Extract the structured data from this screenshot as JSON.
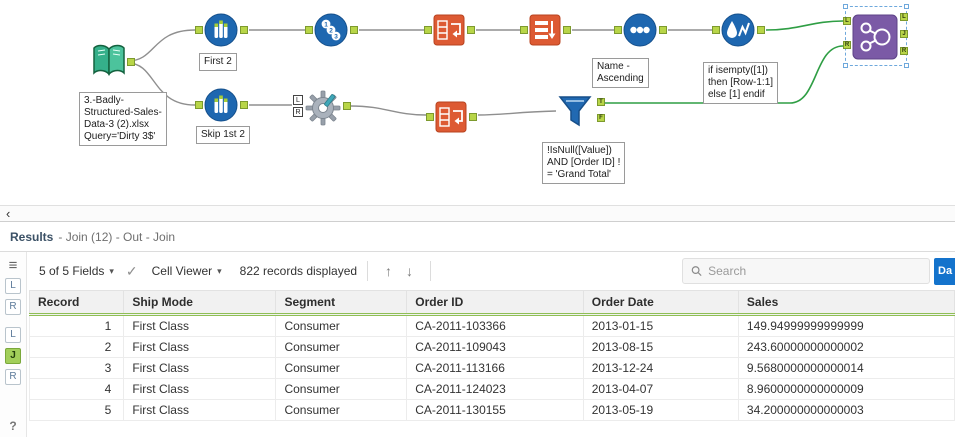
{
  "canvas": {
    "annotations": {
      "input": [
        "3.-Badly-",
        "Structured-Sales-",
        "Data-3 (2).xlsx",
        "Query='Dirty 3$'"
      ],
      "sample_top": "First 2",
      "sample_bottom": "Skip 1st 2",
      "sort": [
        "Name -",
        "Ascending"
      ],
      "multi_row_formula": [
        "if isempty([1])",
        "then [Row-1:1]",
        "else [1] endif"
      ],
      "filter": [
        "!IsNull([Value])",
        "AND [Order ID] !",
        "= 'Grand Total'"
      ]
    },
    "anchor_letters": {
      "l": "L",
      "r": "R",
      "t": "T",
      "f": "F",
      "j": "J"
    }
  },
  "scrollbar": {
    "left_arrow": "‹"
  },
  "results": {
    "title": "Results",
    "subtitle": "- Join (12) - Out - Join",
    "toolbar": {
      "fields_dropdown": "5 of 5 Fields",
      "dropdown_caret": "▾",
      "check_icon": "✓",
      "cell_viewer": "Cell Viewer",
      "records_displayed": "822 records displayed",
      "up_arrow": "↑",
      "down_arrow": "↓",
      "search_placeholder": "Search",
      "data_button": "Da"
    },
    "rail": {
      "menu_icon": "≡",
      "input_left": "L",
      "input_right": "R",
      "output_left": "L",
      "output_join": "J",
      "output_right": "R",
      "help": "?"
    },
    "table": {
      "columns": [
        "Record",
        "Ship Mode",
        "Segment",
        "Order ID",
        "Order Date",
        "Sales"
      ],
      "rows": [
        [
          "1",
          "First Class",
          "Consumer",
          "CA-2011-103366",
          "2013-01-15",
          "149.94999999999999"
        ],
        [
          "2",
          "First Class",
          "Consumer",
          "CA-2011-109043",
          "2013-08-15",
          "243.60000000000002"
        ],
        [
          "3",
          "First Class",
          "Consumer",
          "CA-2011-113166",
          "2013-12-24",
          "9.5680000000000014"
        ],
        [
          "4",
          "First Class",
          "Consumer",
          "CA-2011-124023",
          "2013-04-07",
          "8.9600000000000009"
        ],
        [
          "5",
          "First Class",
          "Consumer",
          "CA-2011-130155",
          "2013-05-19",
          "34.200000000000003"
        ]
      ]
    }
  }
}
